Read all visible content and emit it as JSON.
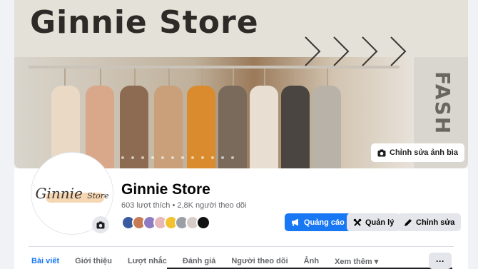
{
  "cover": {
    "title": "Ginnie Store",
    "side_text": "FASH",
    "edit_button_label": "Chỉnh sửa ảnh bìa"
  },
  "avatar": {
    "logo_main": "Ginnie",
    "logo_small": "Store"
  },
  "page": {
    "name": "Ginnie Store",
    "stats": "603 lượt thích • 2,8K người theo dõi"
  },
  "actions": {
    "promote_label": "Quảng cáo",
    "manage_label": "Quản lý",
    "edit_label": "Chỉnh sửa"
  },
  "tabs": [
    {
      "label": "Bài viết",
      "active": true
    },
    {
      "label": "Giới thiệu",
      "active": false
    },
    {
      "label": "Lượt nhắc",
      "active": false
    },
    {
      "label": "Đánh giá",
      "active": false
    },
    {
      "label": "Người theo dõi",
      "active": false
    },
    {
      "label": "Ảnh",
      "active": false
    },
    {
      "label": "Xem thêm ▾",
      "active": false
    }
  ],
  "more_button_label": "···",
  "colors": {
    "accent": "#1877f2",
    "button_gray": "#e4e6eb",
    "text_secondary": "#65676b"
  }
}
